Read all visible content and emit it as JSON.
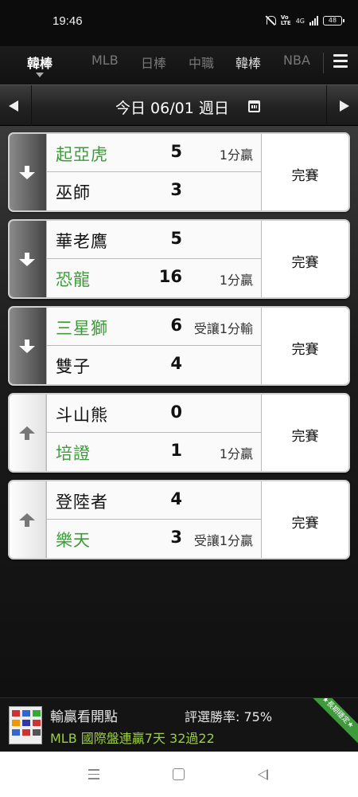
{
  "status_bar": {
    "time": "19:46",
    "network": "4G",
    "volte": "Vo\nLTE",
    "battery": "48"
  },
  "sport_tabs": [
    {
      "label": "韓棒",
      "active": true
    },
    {
      "label": "MLB",
      "active": false
    },
    {
      "label": "日棒",
      "active": false
    },
    {
      "label": "中職",
      "active": false
    },
    {
      "label": "韓棒",
      "active": false
    },
    {
      "label": "NBA",
      "active": false
    }
  ],
  "date_bar": {
    "label": "今日 06/01 週日"
  },
  "games": [
    {
      "arrow": "down",
      "home": {
        "name": "起亞虎",
        "score": "5",
        "note": "1分贏",
        "win": true
      },
      "away": {
        "name": "巫師",
        "score": "3",
        "note": "",
        "win": false
      },
      "status": "完賽"
    },
    {
      "arrow": "down",
      "home": {
        "name": "華老鷹",
        "score": "5",
        "note": "",
        "win": false
      },
      "away": {
        "name": "恐龍",
        "score": "16",
        "note": "1分贏",
        "win": true
      },
      "status": "完賽"
    },
    {
      "arrow": "down",
      "home": {
        "name": "三星獅",
        "score": "6",
        "note": "受讓1分輸",
        "win": true
      },
      "away": {
        "name": "雙子",
        "score": "4",
        "note": "",
        "win": false
      },
      "status": "完賽"
    },
    {
      "arrow": "up",
      "home": {
        "name": "斗山熊",
        "score": "0",
        "note": "",
        "win": false
      },
      "away": {
        "name": "培證",
        "score": "1",
        "note": "1分贏",
        "win": true
      },
      "status": "完賽"
    },
    {
      "arrow": "up",
      "home": {
        "name": "登陸者",
        "score": "4",
        "note": "",
        "win": false
      },
      "away": {
        "name": "樂天",
        "score": "3",
        "note": "受讓1分贏",
        "win": true
      },
      "status": "完賽"
    }
  ],
  "ad": {
    "title": "輸贏看開點",
    "rate": "評選勝率: 75%",
    "promo": "MLB 國際盤連贏7天 32過22",
    "ribbon": "★長期穩定★"
  },
  "colors": {
    "win_green": "#3e9a3b",
    "promo_green": "#9ccf3c",
    "background": "#0b0b0b"
  }
}
